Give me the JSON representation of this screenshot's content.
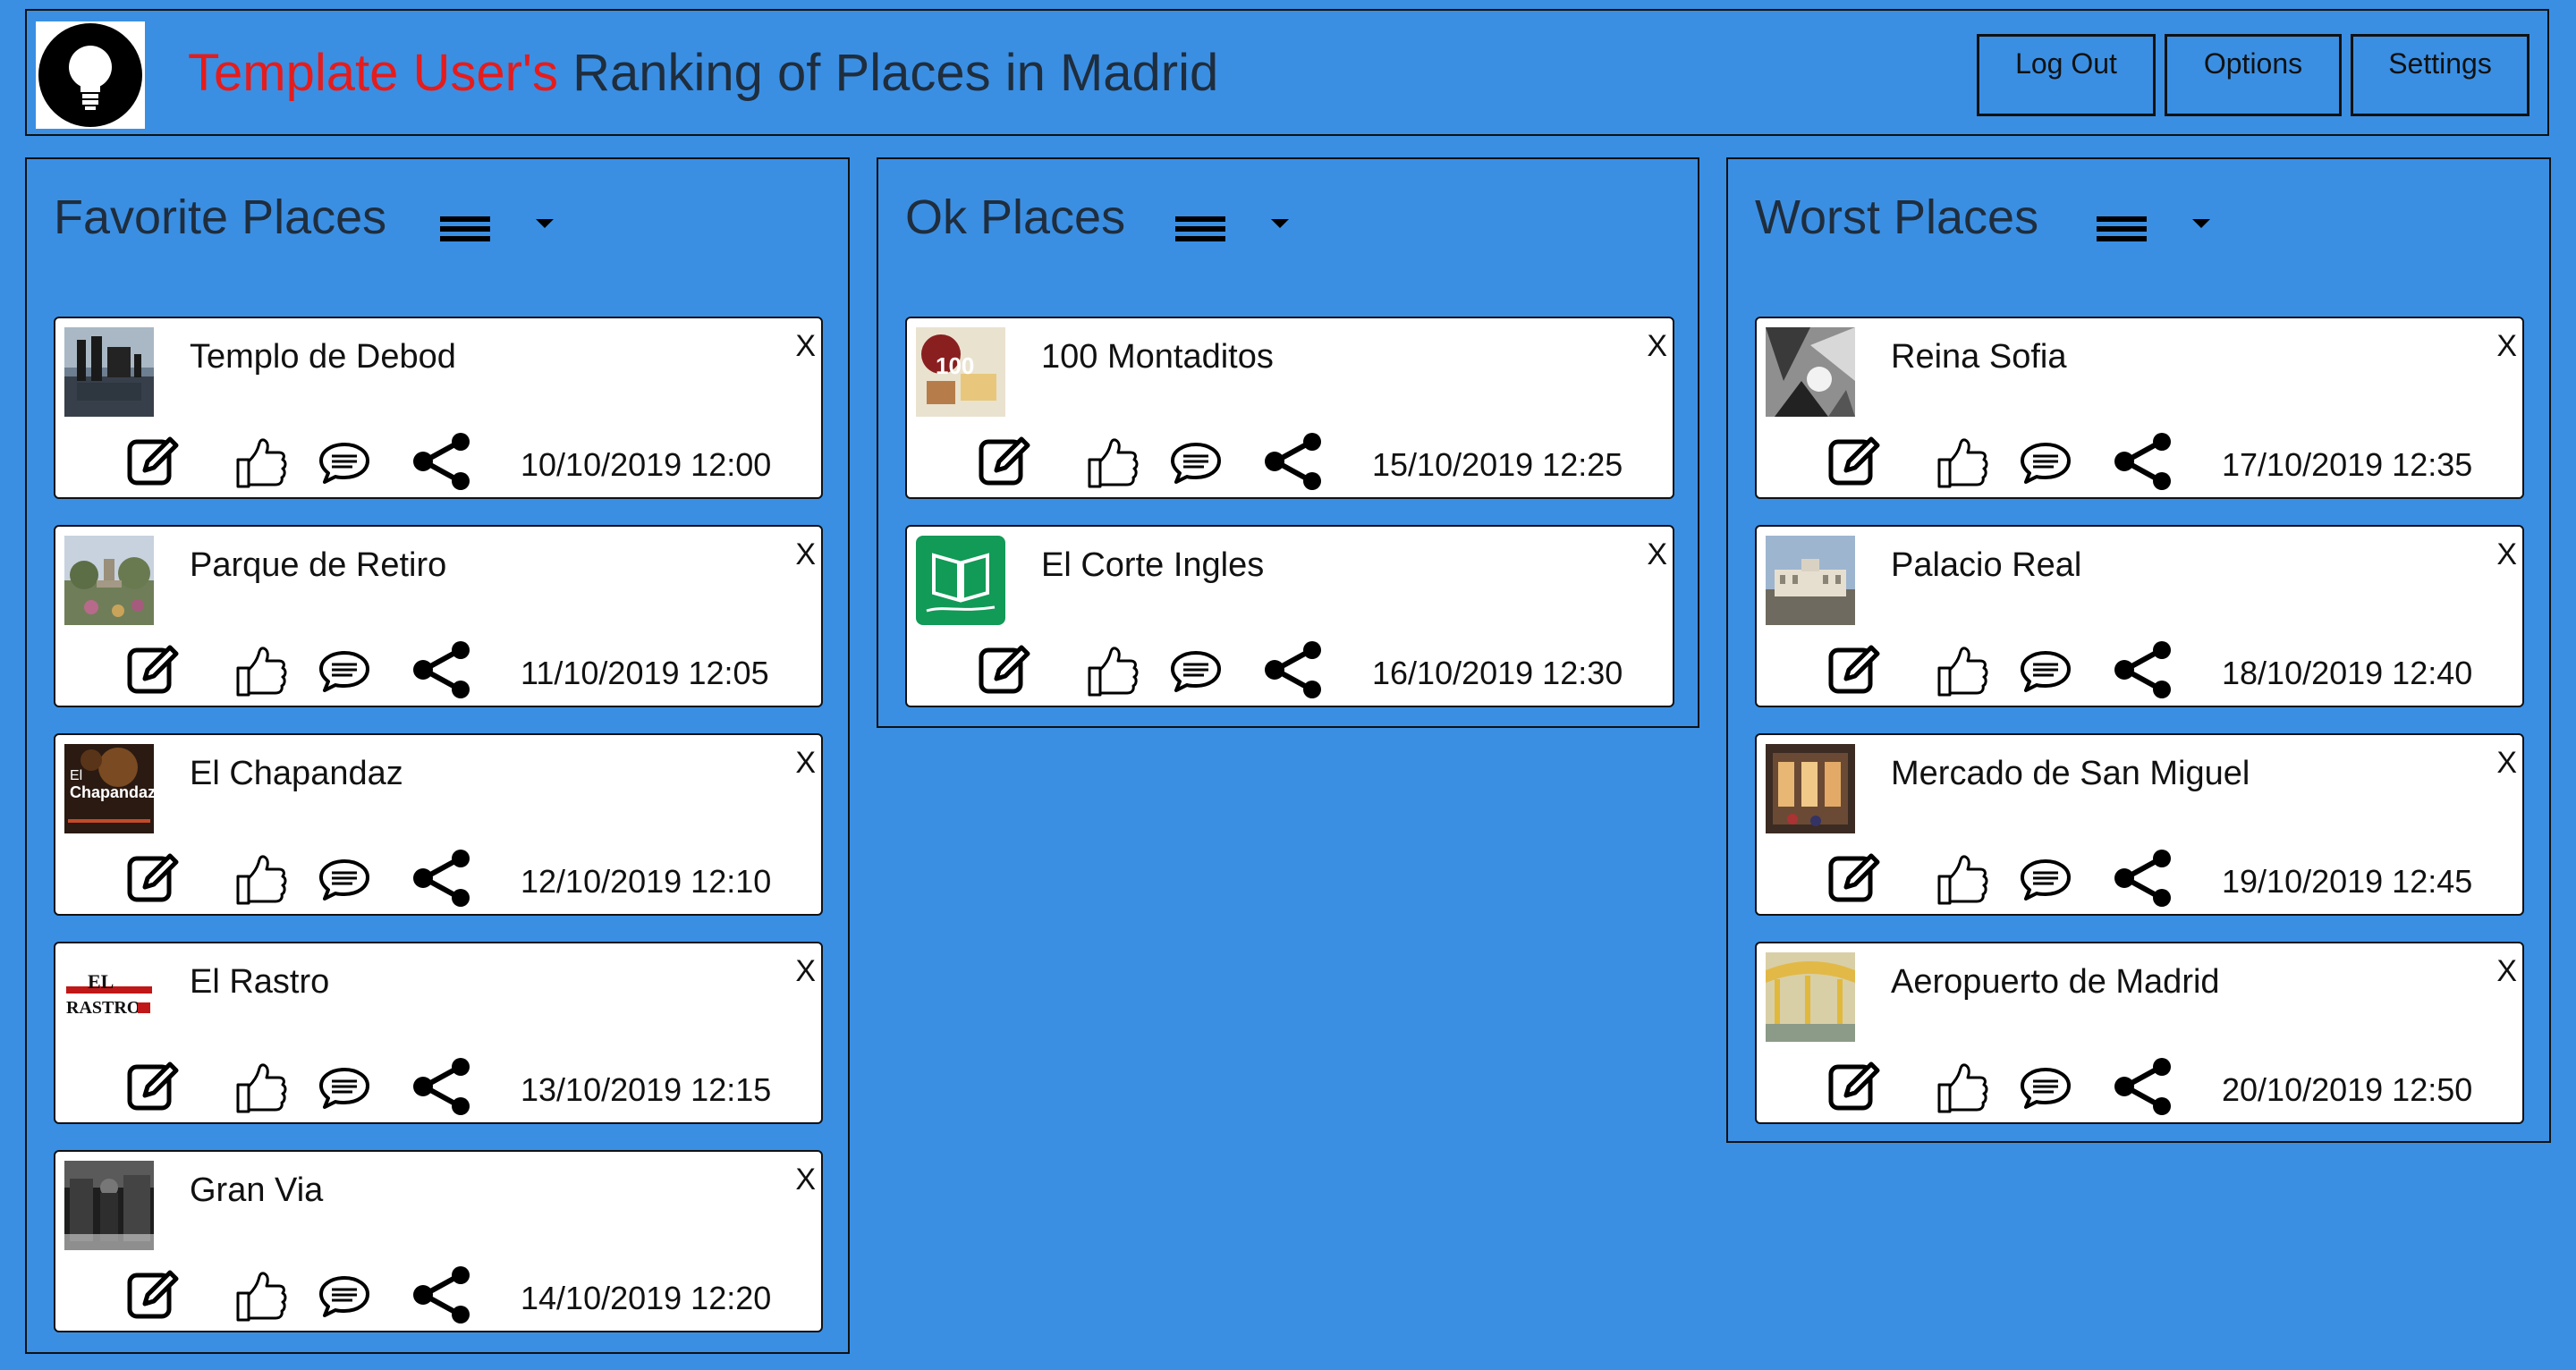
{
  "header": {
    "user_name": "Template User's",
    "title_rest": " Ranking of Places in Madrid",
    "buttons": {
      "logout": "Log Out",
      "options": "Options",
      "settings": "Settings"
    }
  },
  "columns": [
    {
      "title": "Favorite Places",
      "cards": [
        {
          "name": "Templo de Debod",
          "date": "10/10/2019 12:00"
        },
        {
          "name": "Parque de Retiro",
          "date": "11/10/2019 12:05"
        },
        {
          "name": "El Chapandaz",
          "date": "12/10/2019 12:10"
        },
        {
          "name": "El Rastro",
          "date": "13/10/2019 12:15"
        },
        {
          "name": "Gran Via",
          "date": "14/10/2019 12:20"
        }
      ]
    },
    {
      "title": "Ok Places",
      "cards": [
        {
          "name": "100 Montaditos",
          "date": "15/10/2019 12:25"
        },
        {
          "name": "El Corte Ingles",
          "date": "16/10/2019 12:30"
        }
      ]
    },
    {
      "title": "Worst Places",
      "cards": [
        {
          "name": "Reina Sofia",
          "date": "17/10/2019 12:35"
        },
        {
          "name": "Palacio Real",
          "date": "18/10/2019 12:40"
        },
        {
          "name": "Mercado de San Miguel",
          "date": "19/10/2019 12:45"
        },
        {
          "name": "Aeropuerto de Madrid",
          "date": "20/10/2019 12:50"
        }
      ]
    }
  ],
  "labels": {
    "close": "X"
  },
  "thumb_text": {
    "montaditos": "100",
    "chapandaz_1": "El",
    "chapandaz_2": "Chapandaz",
    "rastro_1": "EL",
    "rastro_2": "RASTRO"
  },
  "colors": {
    "background": "#3a8fe3",
    "accent_user": "#e51c1c",
    "card": "#ffffff"
  }
}
